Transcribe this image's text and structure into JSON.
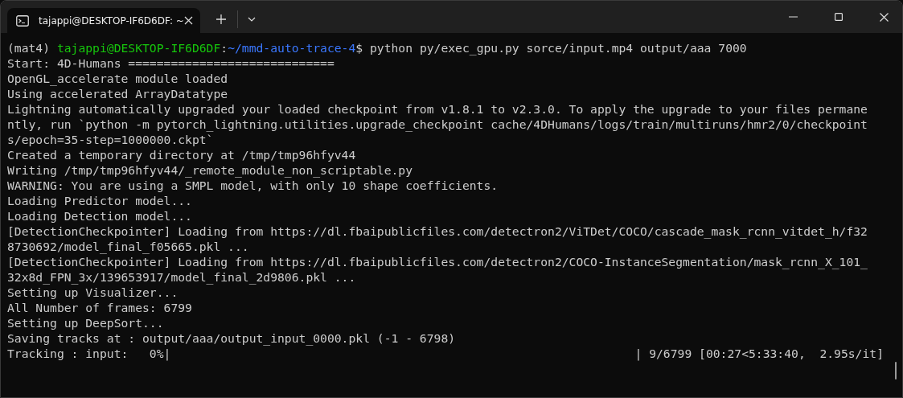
{
  "window": {
    "tab": {
      "title": "tajappi@DESKTOP-IF6D6DF: ~",
      "selected": true
    }
  },
  "terminal": {
    "lines": [
      {
        "kind": "prompt",
        "env": "(mat4) ",
        "user_host": "tajappi@DESKTOP-IF6D6DF",
        "separator": ":",
        "path": "~/mmd-auto-trace-4",
        "command": "$ python py/exec_gpu.py sorce/input.mp4 output/aaa 7000"
      },
      {
        "kind": "text",
        "text": "Start: 4D-Humans ============================="
      },
      {
        "kind": "text",
        "text": "OpenGL_accelerate module loaded"
      },
      {
        "kind": "text",
        "text": "Using accelerated ArrayDatatype"
      },
      {
        "kind": "text",
        "text": "Lightning automatically upgraded your loaded checkpoint from v1.8.1 to v2.3.0. To apply the upgrade to your files permane"
      },
      {
        "kind": "text",
        "text": "ntly, run `python -m pytorch_lightning.utilities.upgrade_checkpoint cache/4DHumans/logs/train/multiruns/hmr2/0/checkpoint"
      },
      {
        "kind": "text",
        "text": "s/epoch=35-step=1000000.ckpt`"
      },
      {
        "kind": "text",
        "text": "Created a temporary directory at /tmp/tmp96hfyv44"
      },
      {
        "kind": "text",
        "text": "Writing /tmp/tmp96hfyv44/_remote_module_non_scriptable.py"
      },
      {
        "kind": "text",
        "text": "WARNING: You are using a SMPL model, with only 10 shape coefficients."
      },
      {
        "kind": "text",
        "text": "Loading Predictor model..."
      },
      {
        "kind": "text",
        "text": "Loading Detection model..."
      },
      {
        "kind": "text",
        "text": "[DetectionCheckpointer] Loading from https://dl.fbaipublicfiles.com/detectron2/ViTDet/COCO/cascade_mask_rcnn_vitdet_h/f32"
      },
      {
        "kind": "text",
        "text": "8730692/model_final_f05665.pkl ..."
      },
      {
        "kind": "text",
        "text": "[DetectionCheckpointer] Loading from https://dl.fbaipublicfiles.com/detectron2/COCO-InstanceSegmentation/mask_rcnn_X_101_"
      },
      {
        "kind": "text",
        "text": "32x8d_FPN_3x/139653917/model_final_2d9806.pkl ..."
      },
      {
        "kind": "text",
        "text": "Setting up Visualizer..."
      },
      {
        "kind": "text",
        "text": "All Number of frames: 6799"
      },
      {
        "kind": "text",
        "text": "Setting up DeepSort..."
      },
      {
        "kind": "text",
        "text": "Saving tracks at : output/aaa/output_input_0000.pkl (-1 - 6798)"
      },
      {
        "kind": "progress",
        "label": "Tracking : input:   0%|",
        "stats": "| 9/6799 [00:27<5:33:40,  2.95s/it]"
      }
    ]
  }
}
